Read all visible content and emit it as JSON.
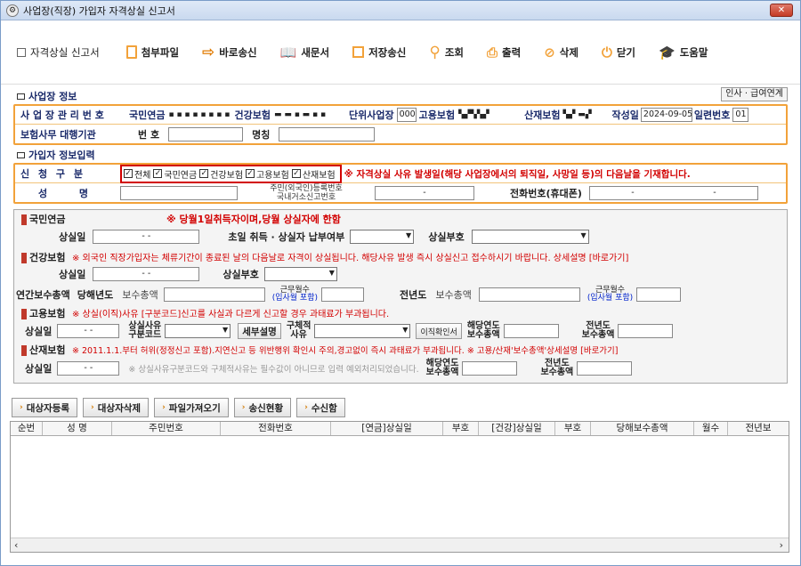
{
  "title": "사업장(직장) 가입자 자격상실 신고서",
  "toolbar": {
    "form_name": "자격상실 신고서",
    "attach": "첨부파일",
    "direct_send": "바로송신",
    "new_doc": "새문서",
    "save_send": "저장송신",
    "search": "조회",
    "print": "출력",
    "delete": "삭제",
    "close": "닫기",
    "help": "도움말"
  },
  "workplace": {
    "header": "사업장 정보",
    "link_btn": "인사 · 급여연계",
    "mgmt_label": "사 업 장 관 리 번 호",
    "pension_label": "국민연금",
    "pension_value": "▪ ▪ ▪ ▪ ▪ ▪ ▪ ▪",
    "health_label": "건강보험",
    "health_value": "▬ ▬ ▪ ▬ ▪ ▪",
    "unit_label": "단위사업장",
    "unit_value": "000",
    "employ_label": "고용보험",
    "employ_value": "▚▞▚▚▞",
    "accident_label": "산재보험",
    "accident_value": "▚▞ ▬▞",
    "date_label": "작성일",
    "date_value": "2024-09-05",
    "serial_label": "일련번호",
    "serial_value": "01",
    "agency_label": "보험사무 대행기관",
    "agency_no_label": "번 호",
    "agency_name_label": "명칭"
  },
  "member": {
    "header": "가입자 정보입력",
    "type_label": "신 청 구 분",
    "cb_all": "전체",
    "cb_pension": "국민연금",
    "cb_health": "건강보험",
    "cb_employ": "고용보험",
    "cb_accident": "산재보험",
    "notice": "※ 자격상실 사유 발생일(해당 사업장에서의 퇴직일, 사망일 등)의 다음날을 기재합니다.",
    "name_label": "성 명",
    "id_label1": "주민(외국인)등록번호",
    "id_label2": "국내거소신고번호",
    "id_value": "-",
    "phone_label": "전화번호(휴대폰)",
    "phone_value1": "-",
    "phone_value2": "-"
  },
  "pension": {
    "title": "국민연금",
    "note": "※ 당월1일취득자이며,당월 상실자에 한함",
    "loss_date": "상실일",
    "loss_date_value": "- -",
    "first_pay": "초일 취득 · 상실자 납부여부",
    "code": "상실부호"
  },
  "health": {
    "title": "건강보험",
    "note": "※ 외국인 직장가입자는 체류기간이 종료된 날의 다음날로 자격이 상실됩니다. 해당사유 발생 즉시 상실신고 접수하시기 바랍니다. 상세설명 [바로가기]",
    "loss_date": "상실일",
    "loss_date_value": "- -",
    "code": "상실부호",
    "annual": "연간보수총액",
    "this_year": "당해년도",
    "pay_total": "보수총액",
    "work_months1": "근무월수",
    "work_months2": "(입사월 포함)",
    "last_year": "전년도",
    "pay_total2": "보수총액",
    "work_months3": "근무월수",
    "work_months4": "(입사월 포함)"
  },
  "employ": {
    "title": "고용보험",
    "note": "※ 상실(이직)사유 [구분코드]신고를 사실과 다르게 신고할 경우 과태료가 부과됩니다.",
    "loss_date": "상실일",
    "loss_date_value": "- -",
    "reason1": "상실사유",
    "reason2": "구분코드",
    "detail_btn": "세부설명",
    "concrete1": "구체적",
    "concrete2": "사유",
    "confirm_btn": "이직확인서",
    "cur1": "해당연도",
    "cur2": "보수총액",
    "prev1": "전년도",
    "prev2": "보수총액"
  },
  "accident": {
    "title": "산재보험",
    "note": "※ 2011.1.1.부터 허위(정정신고 포함).지연신고 등 위반행위 확인시 주의,경고없이 즉시 과태료가 부과됩니다.  ※ 고용/산재'보수총액'상세설명 [바로가기]",
    "loss_date": "상실일",
    "loss_date_value": "- -",
    "hint": "※ 상실사유구분코드와 구체적사유는 필수값이 아니므로 입력 예외처리되었습니다.",
    "cur1": "해당연도",
    "cur2": "보수총액",
    "prev1": "전년도",
    "prev2": "보수총액"
  },
  "actions": {
    "register": "대상자등록",
    "remove": "대상자삭제",
    "import": "파일가져오기",
    "send_status": "송신현황",
    "receive": "수신함"
  },
  "table": {
    "headers": [
      "순번",
      "성 명",
      "주민번호",
      "전화번호",
      "[연금]상실일",
      "부호",
      "[건강]상실일",
      "부호",
      "당해보수총액",
      "월수",
      "전년보"
    ]
  }
}
